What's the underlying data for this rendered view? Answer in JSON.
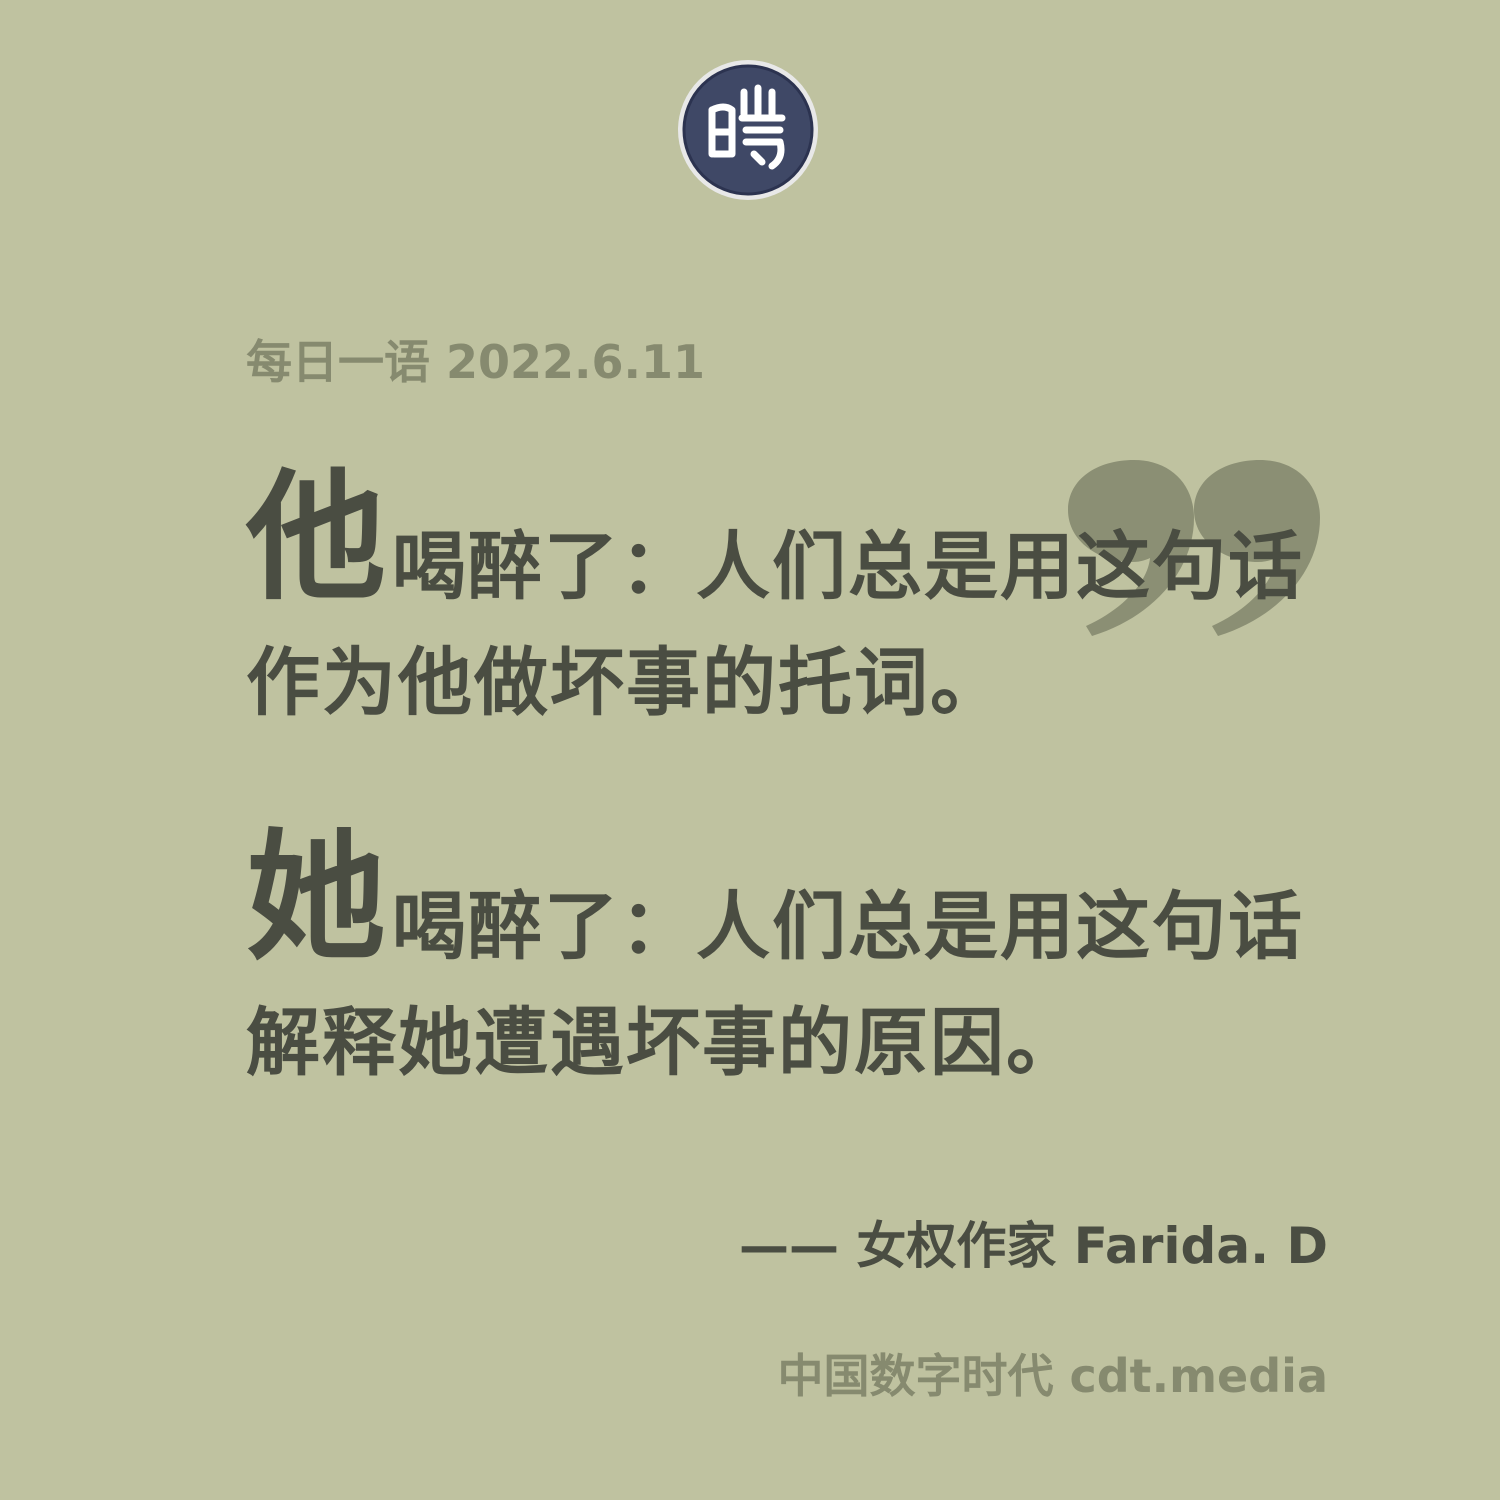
{
  "header": {
    "logo_glyph": "&#26178;",
    "logo_name": "cdt-seal-logo",
    "date_line": "每日一语 2022.6.11"
  },
  "quote": {
    "line1_big": "他",
    "line1_rest": "喝醉了：人们总是用这句话",
    "line2": "作为他做坏事的托词。",
    "line3_big": "她",
    "line3_rest": "喝醉了：人们总是用这句话",
    "line4": "解释她遭遇坏事的原因。"
  },
  "attribution": "—— 女权作家 Farida. D",
  "footer": "中国数字时代 cdt.media",
  "colors": {
    "background": "#bfc2a0",
    "text_dark": "#4a4d42",
    "text_muted": "#868a6f",
    "quote_mark": "#8b8f74",
    "logo_bg": "#3f4866"
  }
}
